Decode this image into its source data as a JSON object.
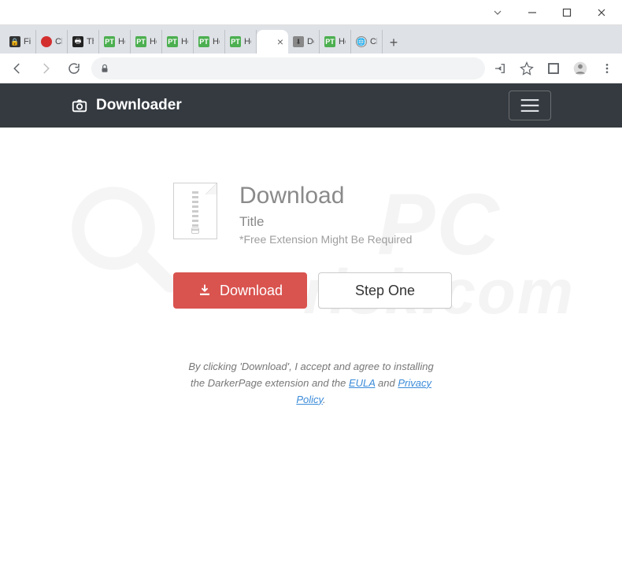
{
  "window": {
    "tabs": [
      {
        "label": "Fil",
        "favicon": "yellow"
      },
      {
        "label": "Cl",
        "favicon": "red"
      },
      {
        "label": "Th",
        "favicon": "dark"
      },
      {
        "label": "Ho",
        "favicon": "green"
      },
      {
        "label": "Ho",
        "favicon": "green"
      },
      {
        "label": "Ho",
        "favicon": "green"
      },
      {
        "label": "Ho",
        "favicon": "green"
      },
      {
        "label": "Ho",
        "favicon": "green"
      },
      {
        "label": "",
        "favicon": "none",
        "active": true
      },
      {
        "label": "Do",
        "favicon": "grey"
      },
      {
        "label": "Ho",
        "favicon": "green"
      },
      {
        "label": "Ch",
        "favicon": "globe"
      }
    ]
  },
  "navbar": {
    "brand": "Downloader"
  },
  "hero": {
    "heading": "Download",
    "title": "Title",
    "note": "*Free Extension Might Be Required"
  },
  "buttons": {
    "download": "Download",
    "step": "Step One"
  },
  "legal": {
    "prefix": "By clicking 'Download', I accept and agree to installing the DarkerPage extension and the ",
    "eula": "EULA",
    "and": " and ",
    "privacy": "Privacy Policy",
    "suffix": "."
  },
  "watermark": {
    "line1": "PC",
    "line2": "risk.com"
  }
}
